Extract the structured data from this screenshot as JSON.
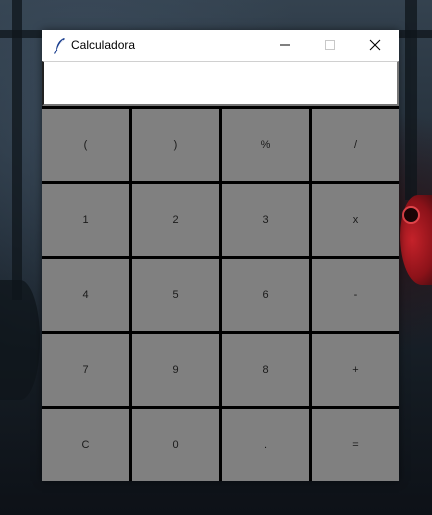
{
  "window": {
    "title": "Calculadora",
    "app_icon": "feather-icon",
    "controls": {
      "minimize_icon": "minimize-icon",
      "maximize_icon": "maximize-icon",
      "close_icon": "close-icon"
    }
  },
  "display": {
    "value": ""
  },
  "keypad": {
    "rows": [
      [
        "(",
        ")",
        "%",
        "/"
      ],
      [
        "1",
        "2",
        "3",
        "x"
      ],
      [
        "4",
        "5",
        "6",
        "-"
      ],
      [
        "7",
        "9",
        "8",
        "+"
      ],
      [
        "C",
        "0",
        ".",
        "="
      ]
    ]
  },
  "colors": {
    "key_background": "#808080",
    "key_text": "#1a1a1a",
    "grid_lines": "#000000",
    "titlebar": "#ffffff",
    "display_background": "#ffffff"
  }
}
